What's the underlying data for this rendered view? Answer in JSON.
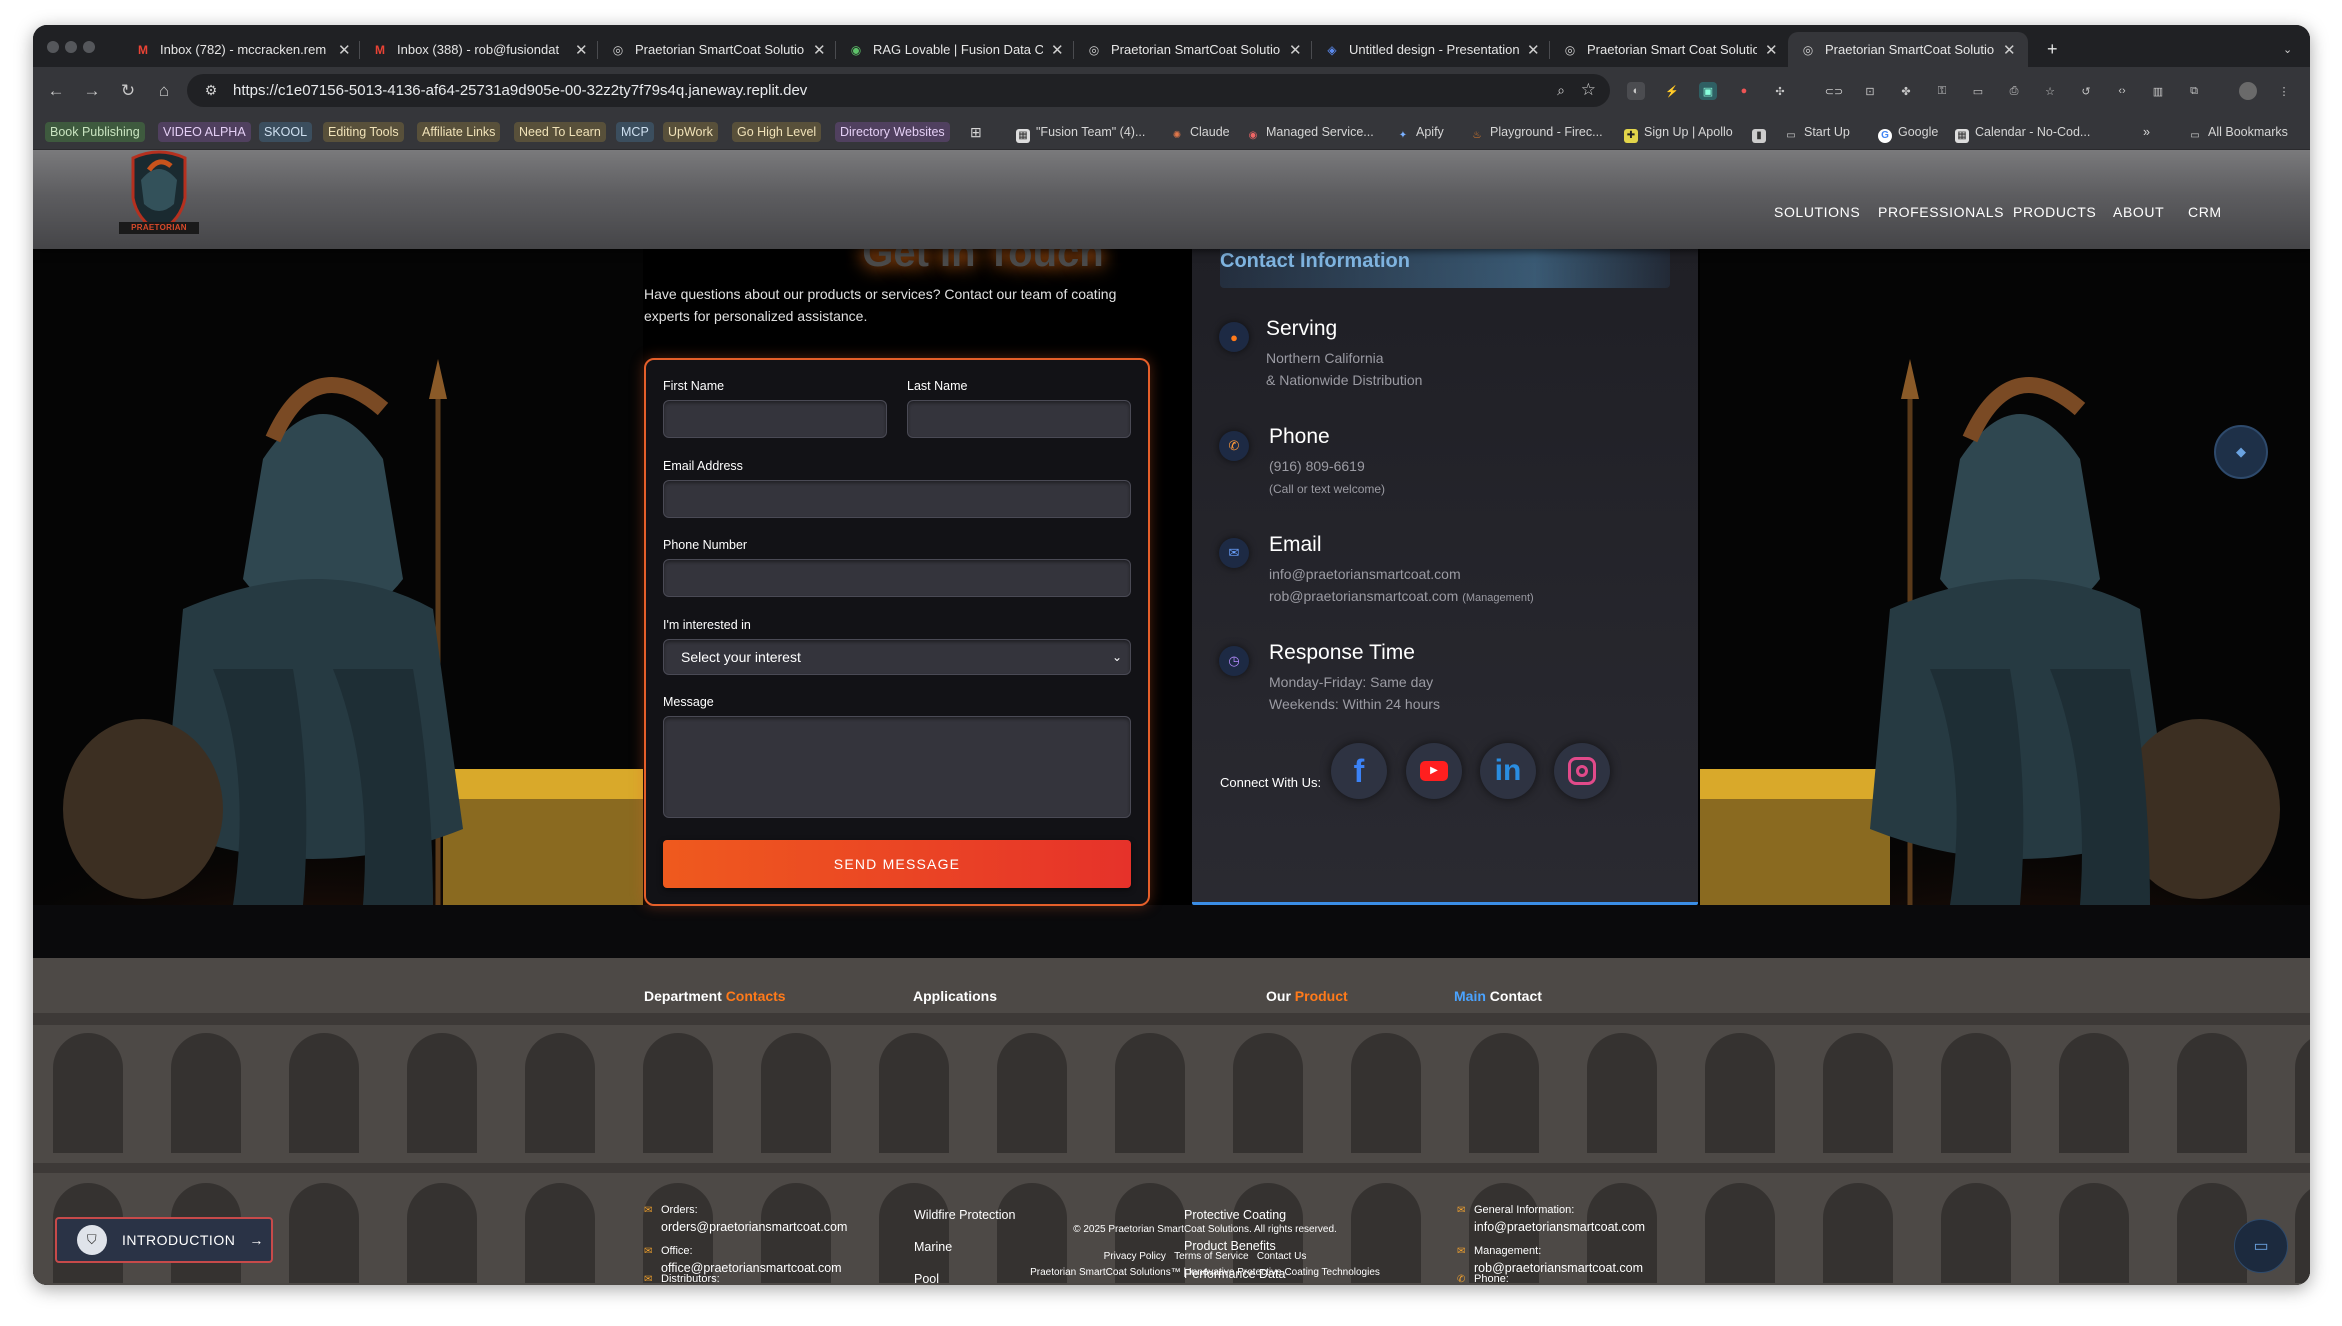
{
  "browser": {
    "tabs": [
      {
        "title": "Inbox (782) - mccracken.rem",
        "icon": "gmail-icon"
      },
      {
        "title": "Inbox (388) - rob@fusiondat",
        "icon": "gmail-icon"
      },
      {
        "title": "Praetorian SmartCoat Solution",
        "icon": "globe-icon"
      },
      {
        "title": "RAG Lovable | Fusion Data Co",
        "icon": "lovable-icon"
      },
      {
        "title": "Praetorian SmartCoat Solution",
        "icon": "globe-icon"
      },
      {
        "title": "Untitled design - Presentation",
        "icon": "canva-icon"
      },
      {
        "title": "Praetorian Smart Coat Solution",
        "icon": "globe-icon"
      },
      {
        "title": "Praetorian SmartCoat Solution",
        "icon": "globe-icon",
        "active": true
      }
    ],
    "new_tab": "+",
    "url": "https://c1e07156-5013-4136-af64-25731a9d905e-00-32z2ty7f79s4q.janeway.replit.dev",
    "bookmarks": [
      {
        "label": "Book Publishing",
        "style": "g"
      },
      {
        "label": "VIDEO ALPHA",
        "style": "p"
      },
      {
        "label": "SKOOL",
        "style": "b"
      },
      {
        "label": "Editing Tools",
        "style": "y"
      },
      {
        "label": "Affiliate Links",
        "style": "y"
      },
      {
        "label": "Need To Learn",
        "style": "y"
      },
      {
        "label": "MCP",
        "style": "b"
      },
      {
        "label": "UpWork",
        "style": "y"
      },
      {
        "label": "Go High Level",
        "style": "y"
      },
      {
        "label": "Directory Websites",
        "style": "p"
      },
      {
        "label": "\"Fusion Team\" (4)...",
        "style": "plain"
      },
      {
        "label": "Claude",
        "style": "plain"
      },
      {
        "label": "Managed Service...",
        "style": "plain"
      },
      {
        "label": "Apify",
        "style": "plain"
      },
      {
        "label": "Playground - Firec...",
        "style": "plain"
      },
      {
        "label": "Sign Up | Apollo",
        "style": "plain"
      },
      {
        "label": "Start Up",
        "style": "plain"
      },
      {
        "label": "Google",
        "style": "plain"
      },
      {
        "label": "Calendar - No-Cod...",
        "style": "plain"
      }
    ],
    "more_bookmarks": "»",
    "all_bookmarks": "All Bookmarks"
  },
  "site": {
    "logo_text": "PRAETORIAN",
    "nav": [
      "SOLUTIONS",
      "PROFESSIONALS",
      "PRODUCTS",
      "ABOUT",
      "CRM"
    ]
  },
  "hero": {
    "heading": "Get In Touch",
    "intro": "Have questions about our products or services? Contact our team of coating experts for personalized assistance."
  },
  "form": {
    "first_name_label": "First Name",
    "last_name_label": "Last Name",
    "email_label": "Email Address",
    "phone_label": "Phone Number",
    "interest_label": "I'm interested in",
    "interest_selected": "Select your interest",
    "message_label": "Message",
    "send_label": "SEND MESSAGE"
  },
  "contact_info": {
    "title": "Contact Information",
    "serving": {
      "title": "Serving",
      "line1": "Northern California",
      "line2": "& Nationwide Distribution"
    },
    "phone": {
      "title": "Phone",
      "number": "(916) 809-6619",
      "note": "(Call or text welcome)"
    },
    "email": {
      "title": "Email",
      "line1": "info@praetoriansmartcoat.com",
      "line2": "rob@praetoriansmartcoat.com",
      "line2_note": "(Management)"
    },
    "response": {
      "title": "Response Time",
      "line1": "Monday-Friday: Same day",
      "line2": "Weekends: Within 24 hours"
    },
    "connect_label": "Connect With Us:",
    "social": [
      "facebook",
      "youtube",
      "linkedin",
      "instagram"
    ]
  },
  "footer": {
    "dept_head": {
      "a": "Department",
      "b": "Contacts"
    },
    "app_head": "Applications",
    "prod_head": {
      "a": "Our",
      "b": "Product"
    },
    "main_head": {
      "a": "Main",
      "b": "Contact"
    },
    "orders_label": "Orders:",
    "orders_email": "orders@praetoriansmartcoat.com",
    "office_label": "Office:",
    "office_email": "office@praetoriansmartcoat.com",
    "distributors_label": "Distributors:",
    "apps": [
      "Wildfire Protection",
      "Marine",
      "Pool"
    ],
    "products": [
      "Protective Coating",
      "Product Benefits",
      "Performance Data"
    ],
    "copyright": "© 2025 Praetorian SmartCoat Solutions. All rights reserved.",
    "privacy": "Privacy Policy",
    "terms": "Terms of Service",
    "contact_us": "Contact Us",
    "tagline": "Praetorian SmartCoat Solutions™ | Innovative Protective Coating Technologies",
    "general_label": "General Information:",
    "general_email": "info@praetoriansmartcoat.com",
    "management_label": "Management:",
    "management_email": "rob@praetoriansmartcoat.com",
    "phone_label": "Phone:"
  },
  "floating": {
    "intro_label": "INTRODUCTION"
  }
}
